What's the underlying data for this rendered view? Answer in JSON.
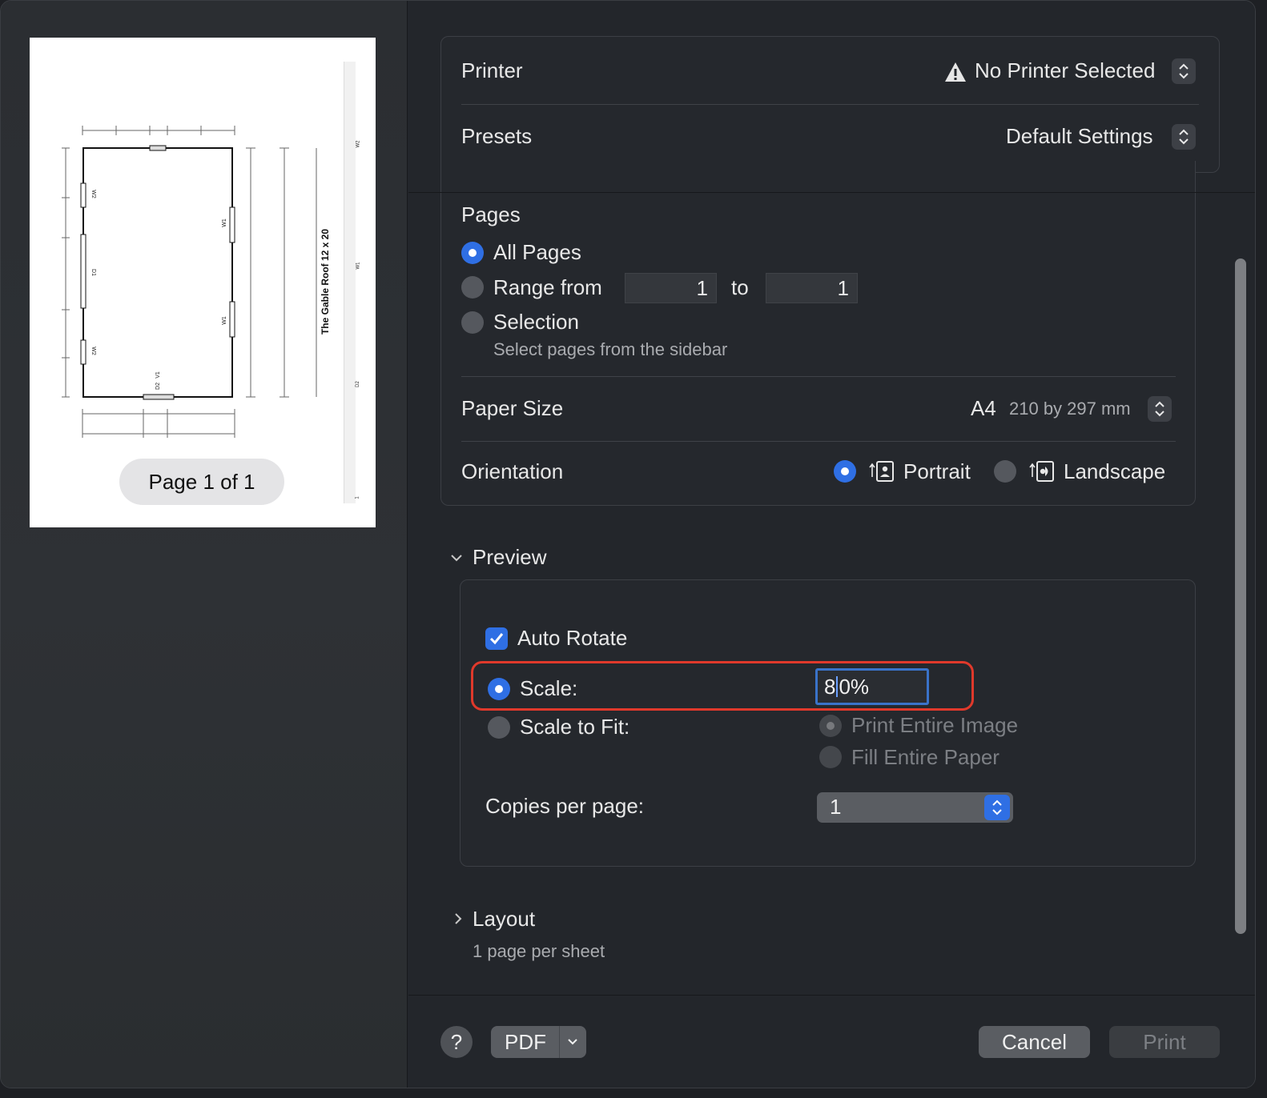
{
  "preview": {
    "page_indicator": "Page 1 of 1",
    "document_title": "The Gable Roof 12 x 20",
    "legend_items": [
      "W2",
      "W1",
      "D2",
      "1"
    ],
    "plan_labels": [
      "W2",
      "W1",
      "D1",
      "W1",
      "W2",
      "D2",
      "V1"
    ]
  },
  "printer": {
    "label": "Printer",
    "value": "No Printer Selected",
    "icon": "warning-icon"
  },
  "presets": {
    "label": "Presets",
    "value": "Default Settings"
  },
  "pages": {
    "label": "Pages",
    "all_pages": "All Pages",
    "range_from": "Range from",
    "range_start": "1",
    "range_to": "to",
    "range_end": "1",
    "selection": "Selection",
    "selection_hint": "Select pages from the sidebar",
    "selected": "all_pages"
  },
  "paper_size": {
    "label": "Paper Size",
    "value": "A4",
    "detail": "210 by 297 mm"
  },
  "orientation": {
    "label": "Orientation",
    "portrait": "Portrait",
    "landscape": "Landscape",
    "selected": "portrait"
  },
  "preview_section": {
    "title": "Preview",
    "expanded": true,
    "auto_rotate": "Auto Rotate",
    "auto_rotate_checked": true,
    "scale_label": "Scale:",
    "scale_value_before_caret": "8",
    "scale_value_after_caret": "0%",
    "scale_to_fit_label": "Scale to Fit:",
    "print_entire_image": "Print Entire Image",
    "fill_entire_paper": "Fill Entire Paper",
    "copies_per_page_label": "Copies per page:",
    "copies_per_page_value": "1",
    "selected_scale_mode": "scale"
  },
  "layout_section": {
    "title": "Layout",
    "expanded": false,
    "summary": "1 page per sheet"
  },
  "footer": {
    "help": "?",
    "pdf": "PDF",
    "cancel": "Cancel",
    "print": "Print"
  },
  "colors": {
    "accent": "#2f6fe4",
    "highlight": "#e0392b",
    "background": "#23262b"
  }
}
